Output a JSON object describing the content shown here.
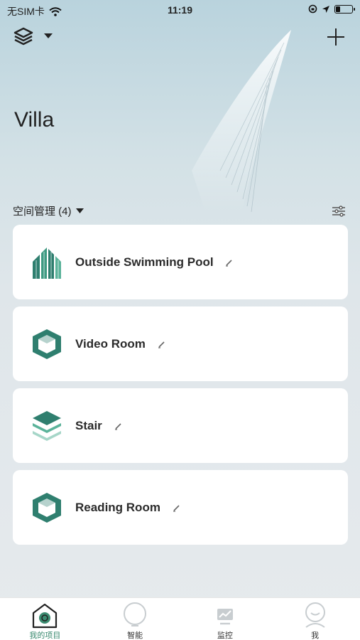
{
  "status_bar": {
    "carrier": "无SIM卡",
    "time": "11:19",
    "battery_level": 0.25
  },
  "header": {
    "layers_icon": "layers-icon",
    "dropdown_icon": "caret-down-icon",
    "add_icon": "plus-icon"
  },
  "project": {
    "title": "Villa"
  },
  "section": {
    "title": "空间管理 (4)",
    "filter_icon": "sliders-icon"
  },
  "rooms": [
    {
      "name": "Outside Swimming Pool",
      "icon": "building-icon"
    },
    {
      "name": "Video Room",
      "icon": "hexagon-box-icon"
    },
    {
      "name": "Stair",
      "icon": "stacked-layers-icon"
    },
    {
      "name": "Reading Room",
      "icon": "hexagon-box-icon"
    }
  ],
  "tabs": [
    {
      "label": "我的项目",
      "icon": "home-icon",
      "active": true
    },
    {
      "label": "智能",
      "icon": "bulb-icon",
      "active": false
    },
    {
      "label": "监控",
      "icon": "monitor-chart-icon",
      "active": false
    },
    {
      "label": "我",
      "icon": "user-icon",
      "active": false
    }
  ],
  "colors": {
    "accent": "#3a8a6f",
    "icon_teal": "#2f7f6f"
  }
}
